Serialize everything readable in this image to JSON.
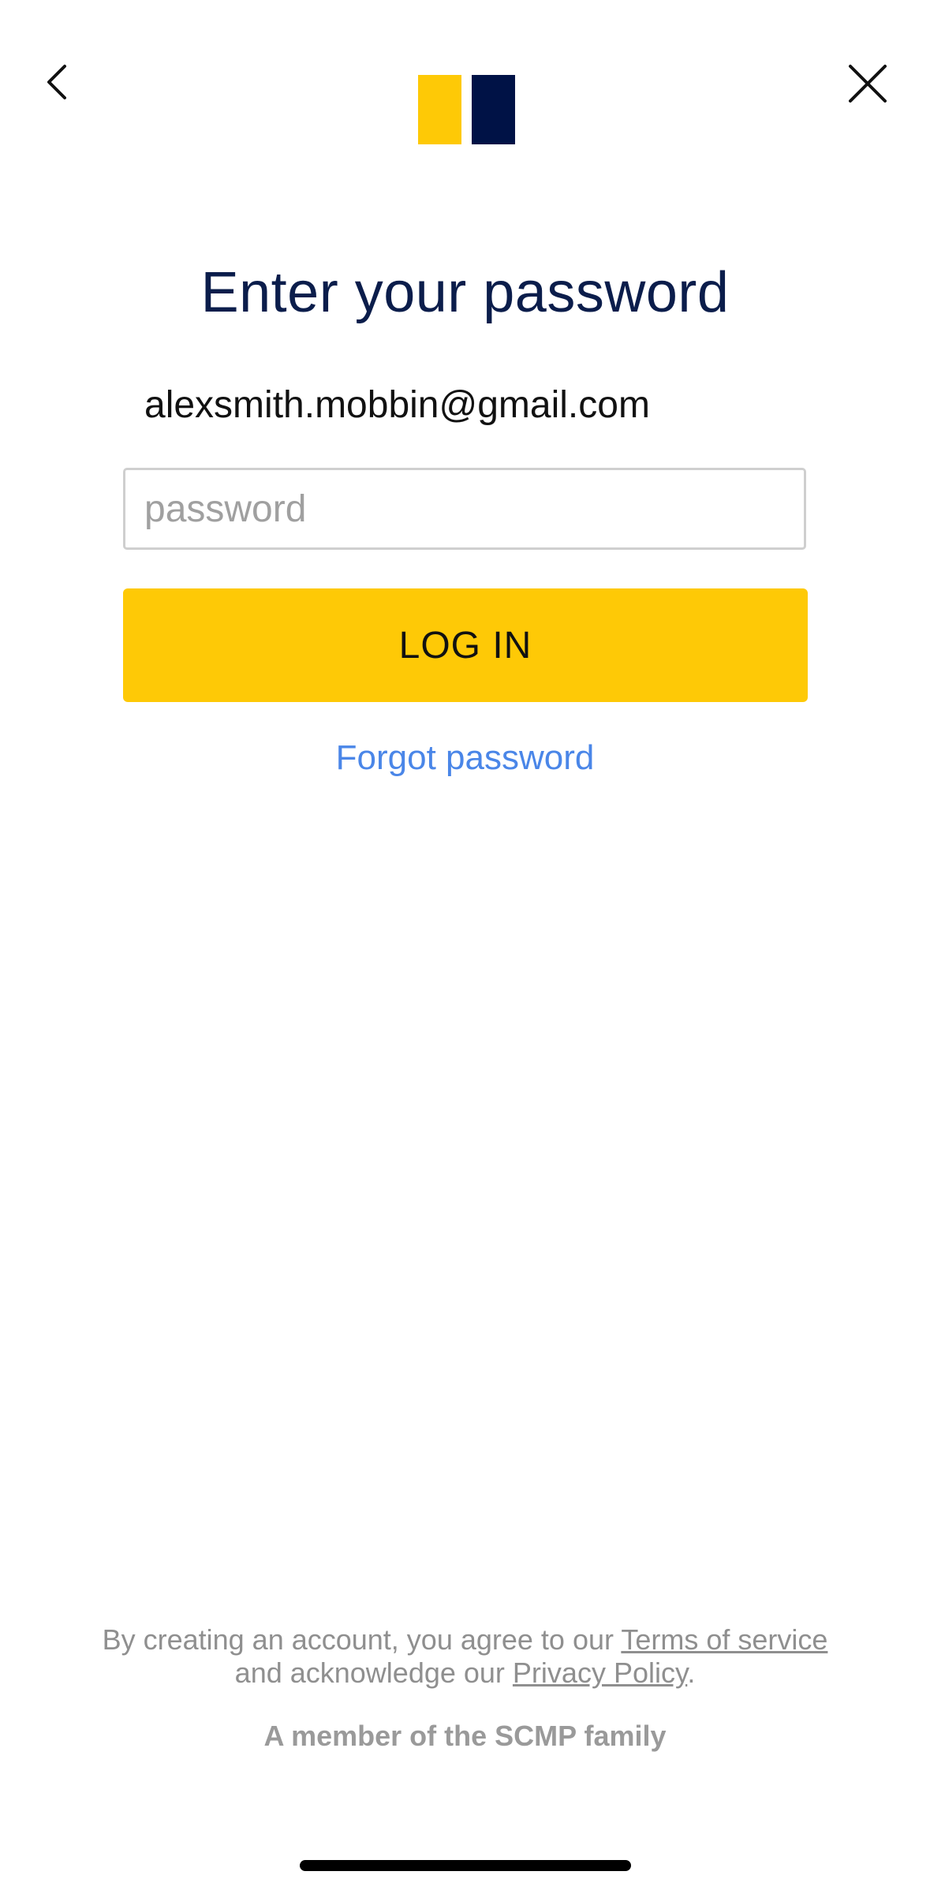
{
  "header": {
    "back_icon": "chevron-left-icon",
    "close_icon": "close-icon",
    "logo_colors": {
      "left": "#fec906",
      "right": "#001246"
    }
  },
  "main": {
    "title": "Enter your password",
    "email": "alexsmith.mobbin@gmail.com",
    "password_placeholder": "password",
    "password_value": "",
    "login_label": "LOG IN",
    "forgot_label": "Forgot password"
  },
  "footer": {
    "legal_prefix": "By creating an account, you agree to our ",
    "terms_label": "Terms of service",
    "legal_middle": "and acknowledge our ",
    "privacy_label": "Privacy Policy",
    "legal_suffix": ".",
    "member_text": "A member of the SCMP family"
  },
  "colors": {
    "accent": "#fec906",
    "title": "#0b1d4b",
    "link": "#4a86e8",
    "muted": "#8f8f8f"
  }
}
